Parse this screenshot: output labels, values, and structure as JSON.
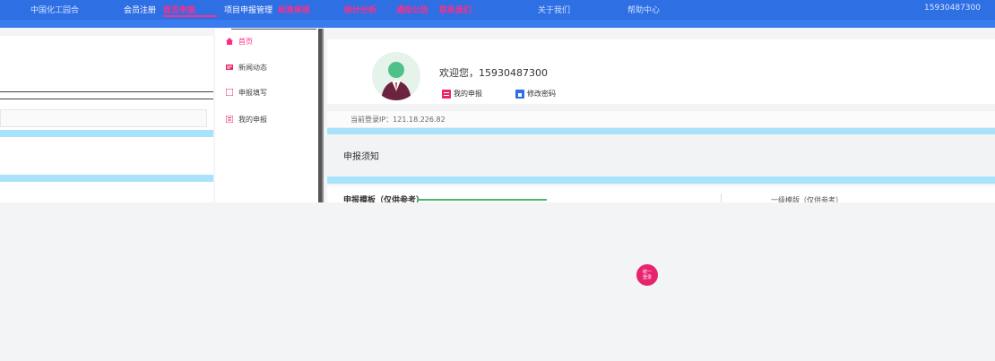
{
  "topbar": {
    "items": [
      {
        "label": "中国化工园合"
      },
      {
        "label": "会员注册"
      },
      {
        "label": "首页申报"
      },
      {
        "label": "项目申报管理"
      },
      {
        "label": "标准审核"
      },
      {
        "label": "统计分析"
      },
      {
        "label": "通知公告"
      },
      {
        "label": "联系我们"
      },
      {
        "label": "关于我们"
      },
      {
        "label": "帮助中心"
      }
    ],
    "phone": "15930487300"
  },
  "menu": {
    "items": [
      {
        "label": "首页",
        "icon": "home-icon"
      },
      {
        "label": "新闻动态",
        "icon": "news-icon"
      },
      {
        "label": "申报填写",
        "icon": "edit-icon"
      },
      {
        "label": "我的申报",
        "icon": "list-icon"
      }
    ]
  },
  "welcome": {
    "greeting": "欢迎您，15930487300",
    "my_apply": "我的申报",
    "change_pwd": "修改密码"
  },
  "login_ip": "当前登录IP：121.18.226.82",
  "notice": {
    "title": "申报须知"
  },
  "template": {
    "title": "申报模板（仅供参考）",
    "right_text": "一级模版（仅供参考）"
  },
  "login_float": {
    "line1": "统一",
    "line2": "登录"
  },
  "colors": {
    "nav_blue": "#2f6fe4",
    "accent_pink": "#ff2d8a",
    "cyan": "#a8e3fb"
  }
}
